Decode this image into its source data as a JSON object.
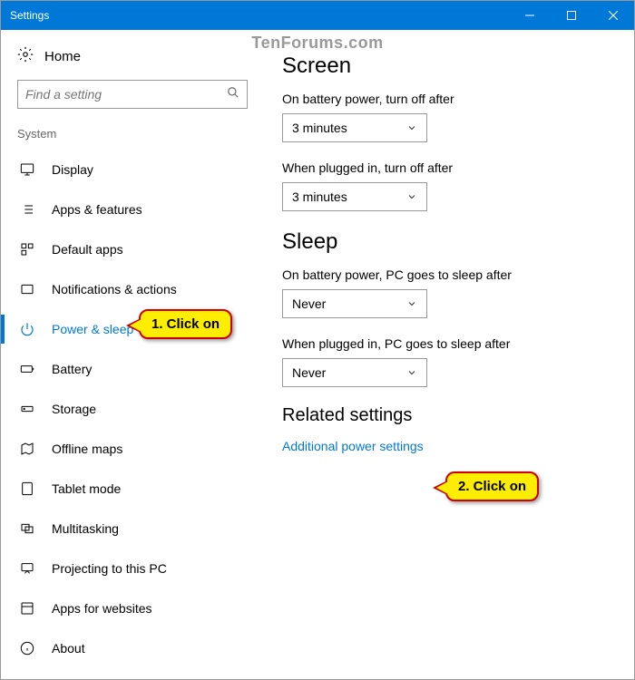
{
  "window": {
    "title": "Settings"
  },
  "watermark": "TenForums.com",
  "home_label": "Home",
  "search": {
    "placeholder": "Find a setting"
  },
  "section_label": "System",
  "nav": {
    "items": [
      {
        "label": "Display"
      },
      {
        "label": "Apps & features"
      },
      {
        "label": "Default apps"
      },
      {
        "label": "Notifications & actions"
      },
      {
        "label": "Power & sleep"
      },
      {
        "label": "Battery"
      },
      {
        "label": "Storage"
      },
      {
        "label": "Offline maps"
      },
      {
        "label": "Tablet mode"
      },
      {
        "label": "Multitasking"
      },
      {
        "label": "Projecting to this PC"
      },
      {
        "label": "Apps for websites"
      },
      {
        "label": "About"
      }
    ]
  },
  "panel": {
    "screen": {
      "heading": "Screen",
      "battery_label": "On battery power, turn off after",
      "battery_value": "3 minutes",
      "plugged_label": "When plugged in, turn off after",
      "plugged_value": "3 minutes"
    },
    "sleep": {
      "heading": "Sleep",
      "battery_label": "On battery power, PC goes to sleep after",
      "battery_value": "Never",
      "plugged_label": "When plugged in, PC goes to sleep after",
      "plugged_value": "Never"
    },
    "related": {
      "heading": "Related settings",
      "link": "Additional power settings"
    }
  },
  "callouts": {
    "c1": "1. Click on",
    "c2": "2. Click on"
  }
}
